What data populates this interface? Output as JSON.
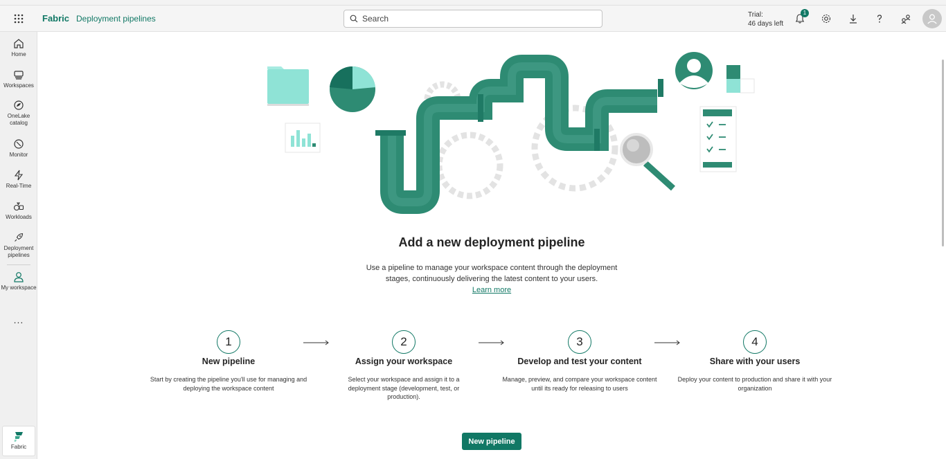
{
  "header": {
    "brand": "Fabric",
    "breadcrumb": "Deployment pipelines",
    "search_placeholder": "Search",
    "trial_line1": "Trial:",
    "trial_line2": "46 days left",
    "notification_count": "1",
    "icons": [
      "app-launcher-icon",
      "search-icon",
      "bell-icon",
      "gear-icon",
      "download-icon",
      "help-icon",
      "share-icon",
      "account-icon"
    ]
  },
  "sidebar": {
    "items": [
      {
        "label": "Home",
        "icon": "home-icon"
      },
      {
        "label": "Workspaces",
        "icon": "workspaces-icon"
      },
      {
        "label": "OneLake catalog",
        "icon": "onelake-icon"
      },
      {
        "label": "Monitor",
        "icon": "monitor-icon"
      },
      {
        "label": "Real-Time",
        "icon": "realtime-icon"
      },
      {
        "label": "Workloads",
        "icon": "workloads-icon"
      },
      {
        "label": "Deployment pipelines",
        "icon": "rocket-icon"
      },
      {
        "label": "My workspace",
        "icon": "person-icon"
      }
    ],
    "more": "...",
    "fabric_label": "Fabric"
  },
  "main": {
    "title": "Add a new deployment pipeline",
    "description": "Use a pipeline to manage your workspace content through the deployment stages, continuously delivering the latest content to your users.",
    "learn_more": "Learn more",
    "steps": [
      {
        "number": "1",
        "title": "New pipeline",
        "description": "Start by creating the pipeline you'll use for managing and deploying the workspace content"
      },
      {
        "number": "2",
        "title": "Assign your workspace",
        "description": "Select your workspace and assign it to a deployment stage (development, test, or production)."
      },
      {
        "number": "3",
        "title": "Develop and test your content",
        "description": "Manage, preview, and compare your workspace content until its ready for releasing to users"
      },
      {
        "number": "4",
        "title": "Share with your users",
        "description": "Deploy your content to production and share it with your organization"
      }
    ],
    "cta_label": "New pipeline"
  },
  "colors": {
    "accent": "#117865",
    "pipe": "#2e8b73",
    "light_teal": "#8fe3d6"
  }
}
